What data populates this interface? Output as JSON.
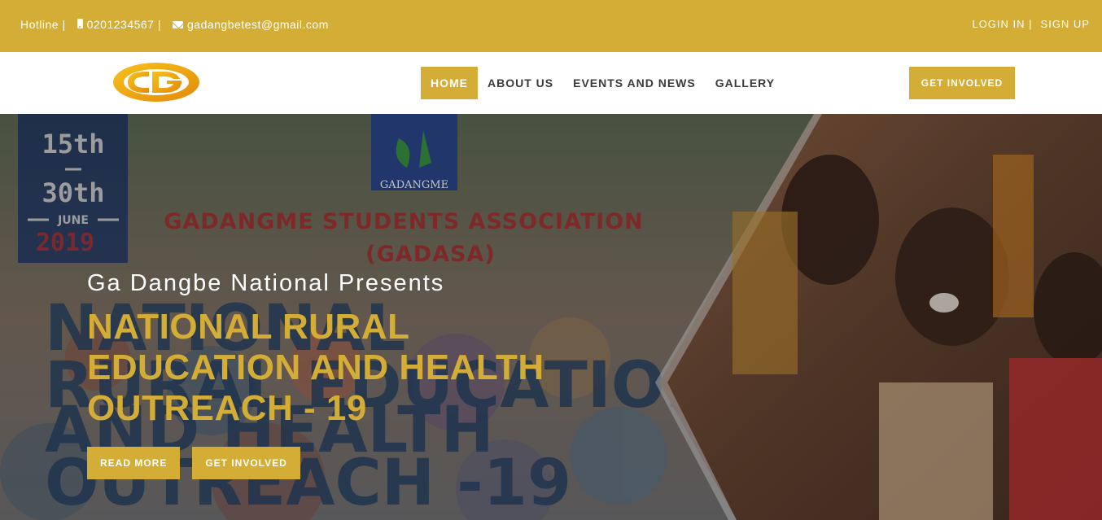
{
  "topbar": {
    "hotline_label": "Hotline |",
    "phone": "0201234567 |",
    "email": "gadangbetest@gmail.com",
    "login": "LOGIN IN |",
    "signup": "SIGN UP"
  },
  "nav": {
    "items": [
      {
        "label": "HOME",
        "active": true
      },
      {
        "label": "ABOUT US",
        "active": false
      },
      {
        "label": "EVENTS AND NEWS",
        "active": false
      },
      {
        "label": "GALLERY",
        "active": false
      }
    ],
    "cta": "GET INVOLVED"
  },
  "hero": {
    "kicker": "Ga Dangbe National Presents",
    "title": "NATIONAL RURAL EDUCATION AND HEALTH OUTREACH - 19",
    "read_more": "READ MORE",
    "get_involved": "GET INVOLVED",
    "poster": {
      "date_top": "15th",
      "date_mid": "30th",
      "month": "JUNE",
      "year": "2019",
      "badge": "GADANGME",
      "org": "GADANGME STUDENTS ASSOCIATION",
      "org_abbr": "(GADASA)",
      "bg_line1": "NATIONAL",
      "bg_line2": "RURAL EDUCATION",
      "bg_line3": "AND HEALTH",
      "bg_line4": "OUTREACH -19"
    }
  },
  "colors": {
    "accent": "#d3ad36",
    "nav_text": "#3a3a3a"
  }
}
